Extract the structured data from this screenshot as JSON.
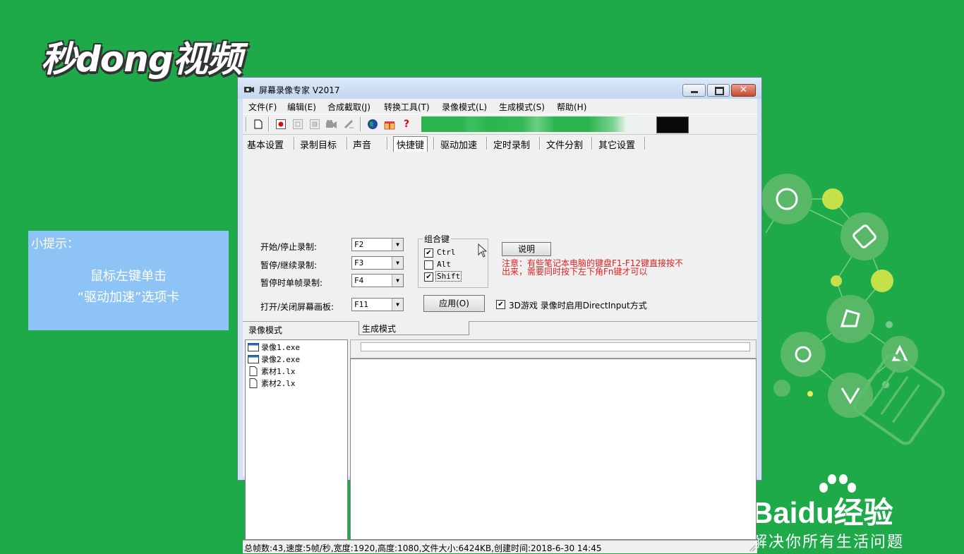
{
  "logo": {
    "text": "秒dong视频"
  },
  "tip": {
    "title": "小提示：",
    "line1": "鼠标左键单击",
    "line2": "“驱动加速”选项卡"
  },
  "baidu": {
    "main": "Baidu经验",
    "sub": "解决你所有生活问题"
  },
  "window": {
    "title": "屏幕录像专家 V2017",
    "menus": [
      "文件(F)",
      "编辑(E)",
      "合成截取(J)",
      "转换工具(T)",
      "录像模式(L)",
      "生成模式(S)",
      "帮助(H)"
    ],
    "tabs": [
      "基本设置",
      "录制目标",
      "声音",
      "快捷键",
      "驱动加速",
      "定时录制",
      "文件分割",
      "其它设置"
    ],
    "active_tab": "快捷键",
    "hotkeys": [
      {
        "label": "开始/停止录制:",
        "value": "F2"
      },
      {
        "label": "暂停/继续录制:",
        "value": "F3"
      },
      {
        "label": "暂停时单帧录制:",
        "value": "F4"
      },
      {
        "label": "打开/关闭屏幕画板:",
        "value": "F11"
      }
    ],
    "combo_group": {
      "title": "组合键",
      "options": [
        {
          "label": "Ctrl",
          "checked": true
        },
        {
          "label": "Alt",
          "checked": false
        },
        {
          "label": "Shift",
          "checked": true
        }
      ]
    },
    "explain_button": "说明",
    "note": "注意：有些笔记本电脑的键盘F1-F12键直接按不出来，需要同时按下左下角Fn键才可以",
    "apply_button": "应用(O)",
    "directinput": {
      "label": "3D游戏 录像时启用DirectInput方式",
      "checked": true
    },
    "section_left": "录像模式",
    "section_right": "生成模式",
    "tree_items": [
      {
        "name": "录像1.exe",
        "type": "exe"
      },
      {
        "name": "录像2.exe",
        "type": "exe"
      },
      {
        "name": "素材1.lx",
        "type": "file"
      },
      {
        "name": "素材2.lx",
        "type": "file"
      }
    ],
    "status": "总帧数:43,速度:5帧/秒,宽度:1920,高度:1080,文件大小:6424KB,创建时间:2018-6-30 14:45"
  }
}
